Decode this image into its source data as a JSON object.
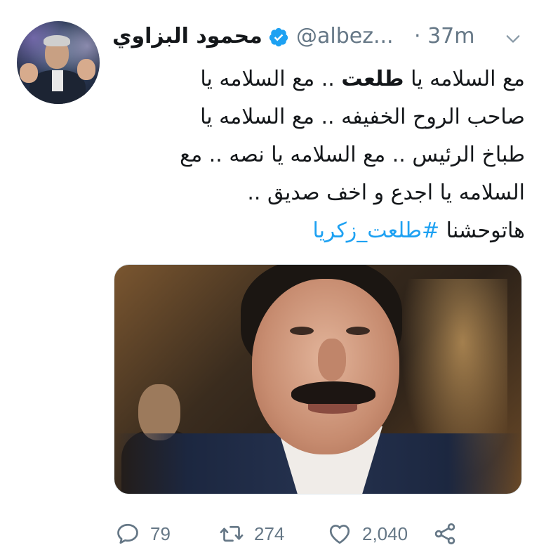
{
  "tweet": {
    "author": {
      "display_name": "محمود البزاوي",
      "handle": "@albez...",
      "verified": true
    },
    "time": "· 37m",
    "body": {
      "line1_a": "مع السلامه يا ",
      "line1_bold": "طلعت",
      "line1_b": " .. مع السلامه يا",
      "line2": "صاحب الروح الخفيفه .. مع السلامه يا",
      "line3": "طباخ الرئيس .. مع السلامه يا نصه .. مع",
      "line4": "السلامه يا اجدع و اخف صديق ..",
      "line5_text": "هاتوحشنا ",
      "hashtag": "#طلعت_زكريا"
    },
    "actions": {
      "reply_count": "79",
      "retweet_count": "274",
      "like_count": "2,040"
    },
    "colors": {
      "link": "#1da1f2",
      "muted": "#657786",
      "verified": "#1da1f2"
    },
    "icons": {
      "verified": "verified-badge-icon",
      "menu": "chevron-down-icon",
      "reply": "reply-icon",
      "retweet": "retweet-icon",
      "like": "heart-icon",
      "share": "share-icon"
    }
  }
}
